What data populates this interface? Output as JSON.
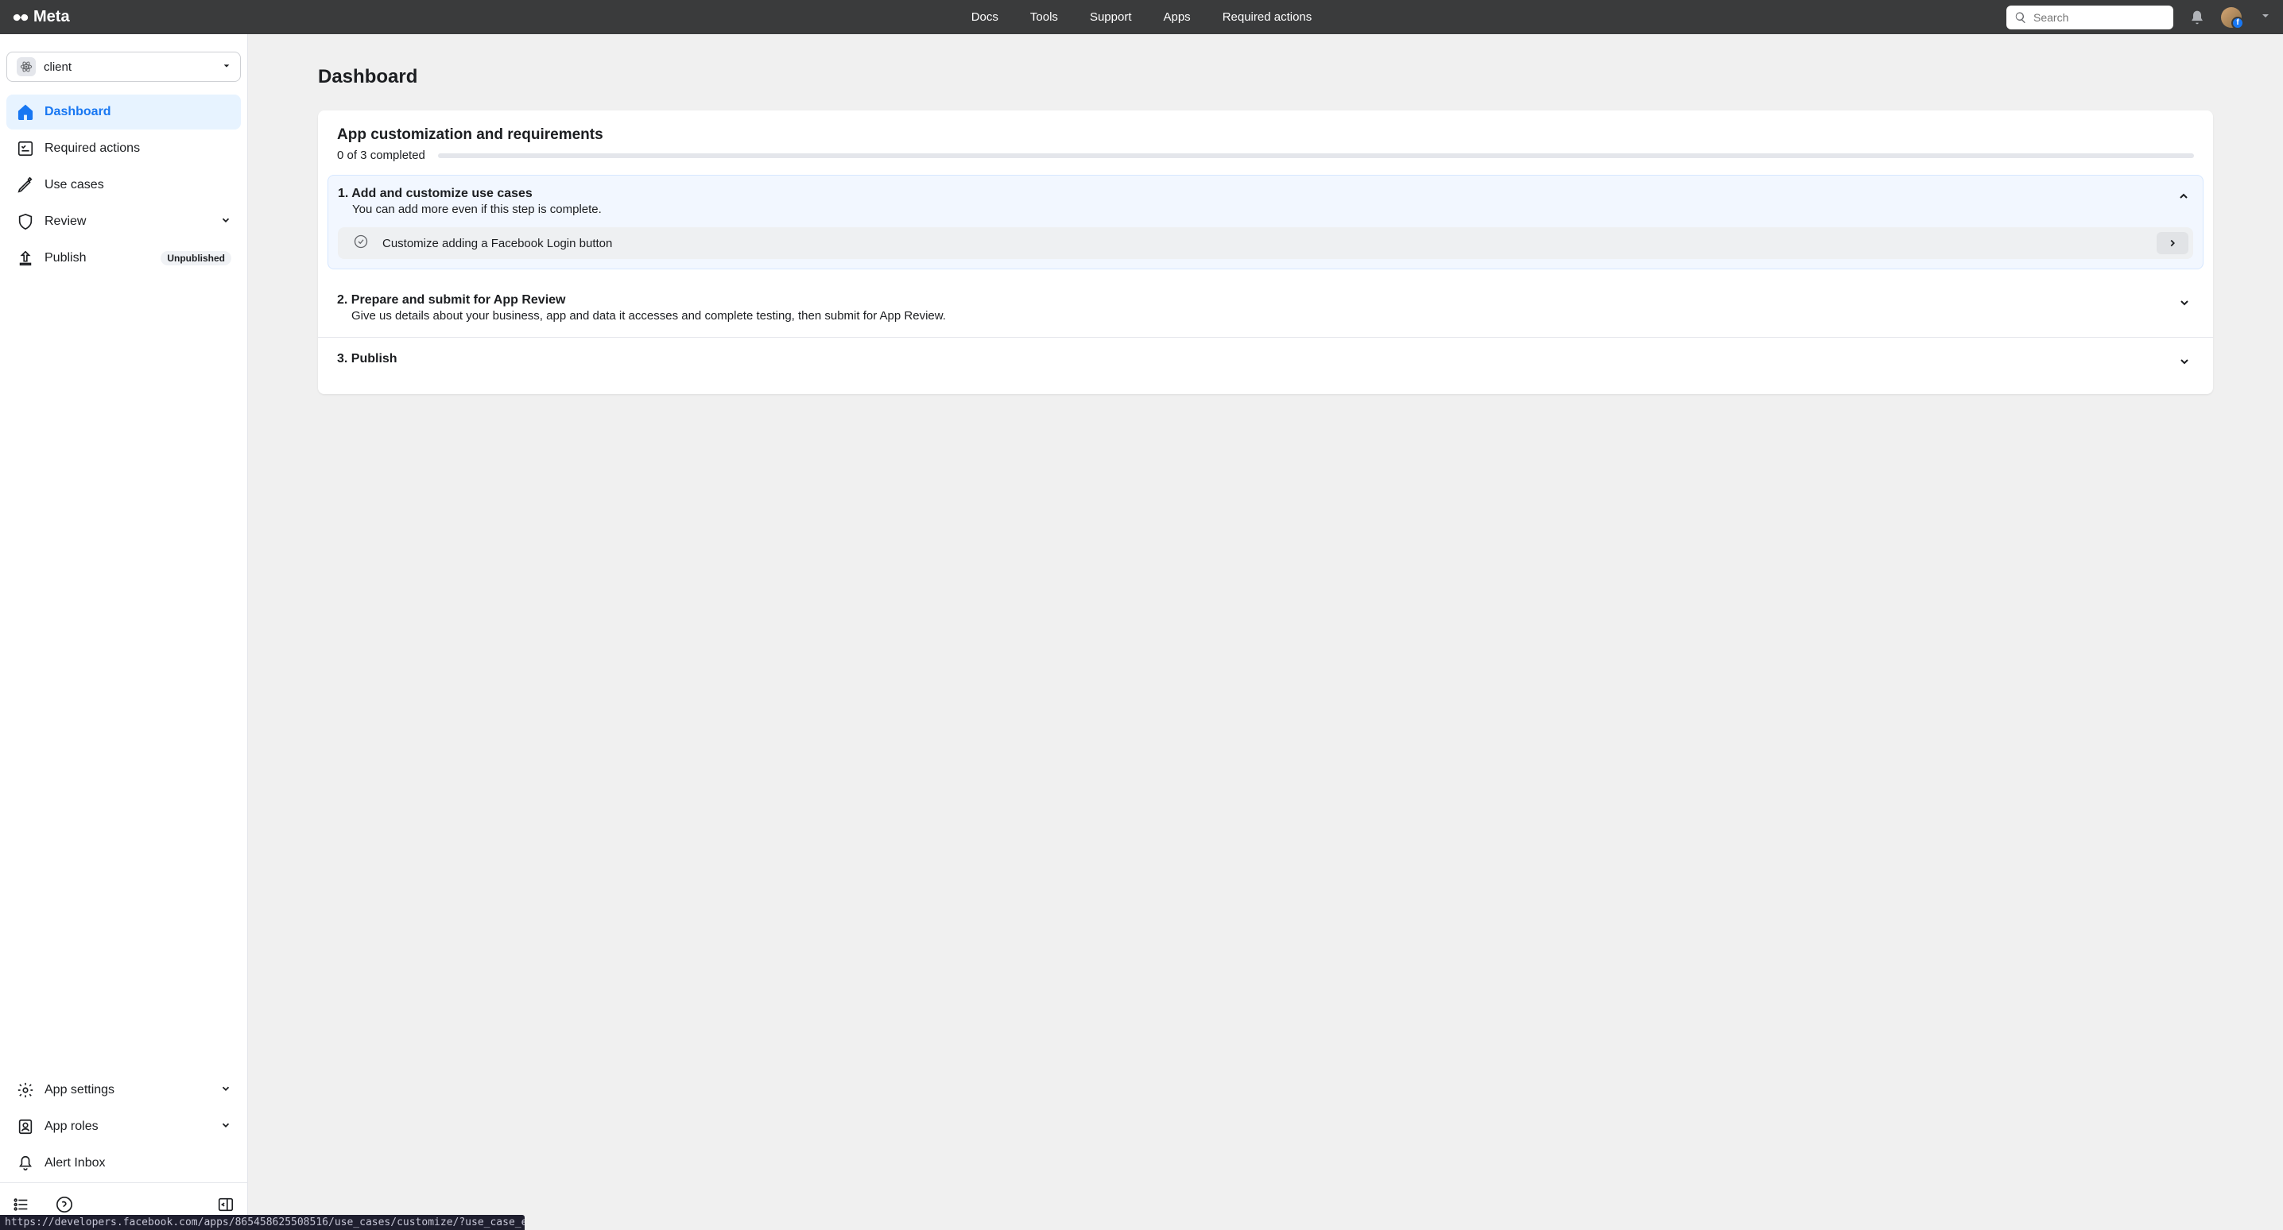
{
  "brand": "Meta",
  "nav": {
    "docs": "Docs",
    "tools": "Tools",
    "support": "Support",
    "apps": "Apps",
    "required_actions": "Required actions"
  },
  "search": {
    "placeholder": "Search"
  },
  "app_selector": {
    "name": "client"
  },
  "sidebar": {
    "dashboard": "Dashboard",
    "required_actions": "Required actions",
    "use_cases": "Use cases",
    "review": "Review",
    "publish": "Publish",
    "publish_badge": "Unpublished",
    "app_settings": "App settings",
    "app_roles": "App roles",
    "alert_inbox": "Alert Inbox"
  },
  "page": {
    "title": "Dashboard"
  },
  "card": {
    "title": "App customization and requirements",
    "progress_text": "0 of 3 completed"
  },
  "steps": {
    "s1": {
      "title": "1. Add and customize use cases",
      "desc": "You can add more even if this step is complete.",
      "task": "Customize adding a Facebook Login button"
    },
    "s2": {
      "title": "2. Prepare and submit for App Review",
      "desc": "Give us details about your business, app and data it accesses and complete testing, then submit for App Review."
    },
    "s3": {
      "title": "3. Publish"
    }
  },
  "status_url": "https://developers.facebook.com/apps/865458625508516/use_cases/customize/?use_case_enum=FB_LOGIN"
}
